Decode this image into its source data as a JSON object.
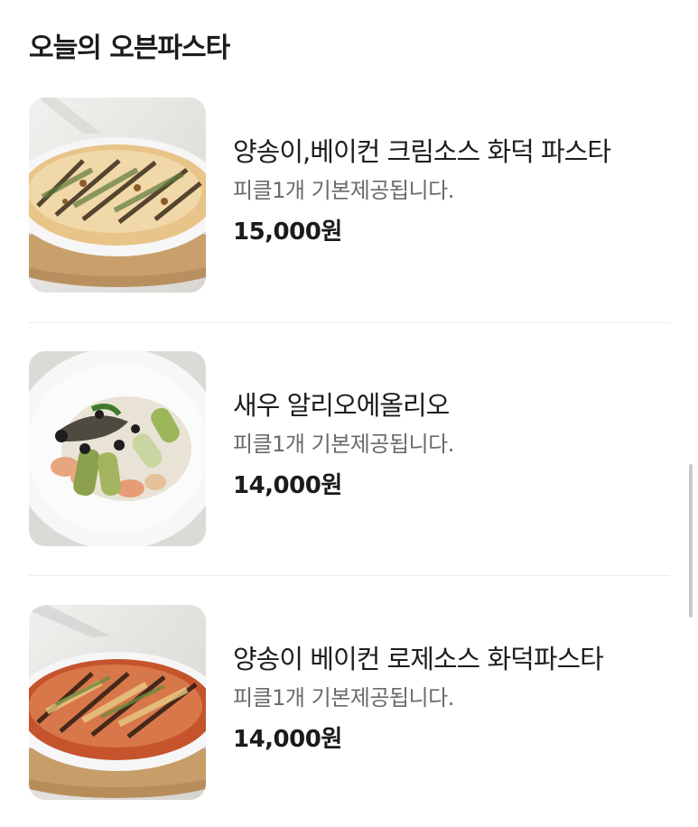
{
  "header": {
    "title": "오늘의 오븐파스타"
  },
  "menu": {
    "items": [
      {
        "name": "양송이,베이컨 크림소스 화덕 파스타",
        "description": "피클1개 기본제공됩니다.",
        "price": "15,000원",
        "image": "cream-pasta-photo"
      },
      {
        "name": "새우 알리오에올리오",
        "description": "피클1개 기본제공됩니다.",
        "price": "14,000원",
        "image": "shrimp-aglio-olio-photo"
      },
      {
        "name": "양송이 베이컨 로제소스 화덕파스타",
        "description": "피클1개 기본제공됩니다.",
        "price": "14,000원",
        "image": "rose-pasta-photo"
      }
    ]
  }
}
